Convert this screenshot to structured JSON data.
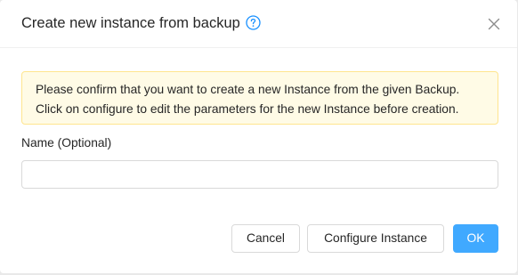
{
  "dialog": {
    "title": "Create new instance from backup",
    "help_icon": "question-circle-icon",
    "close_icon": "close-icon"
  },
  "alert": {
    "line1": "Please confirm that you want to create a new Instance from the given Backup.",
    "line2": "Click on configure to edit the parameters for the new Instance before creation."
  },
  "form": {
    "name_label": "Name (Optional)",
    "name_value": "",
    "name_placeholder": ""
  },
  "footer": {
    "cancel_label": "Cancel",
    "configure_label": "Configure Instance",
    "ok_label": "OK"
  },
  "colors": {
    "primary": "#40a9ff",
    "alert_background": "#fffbe6",
    "alert_border": "#ffe58f"
  }
}
